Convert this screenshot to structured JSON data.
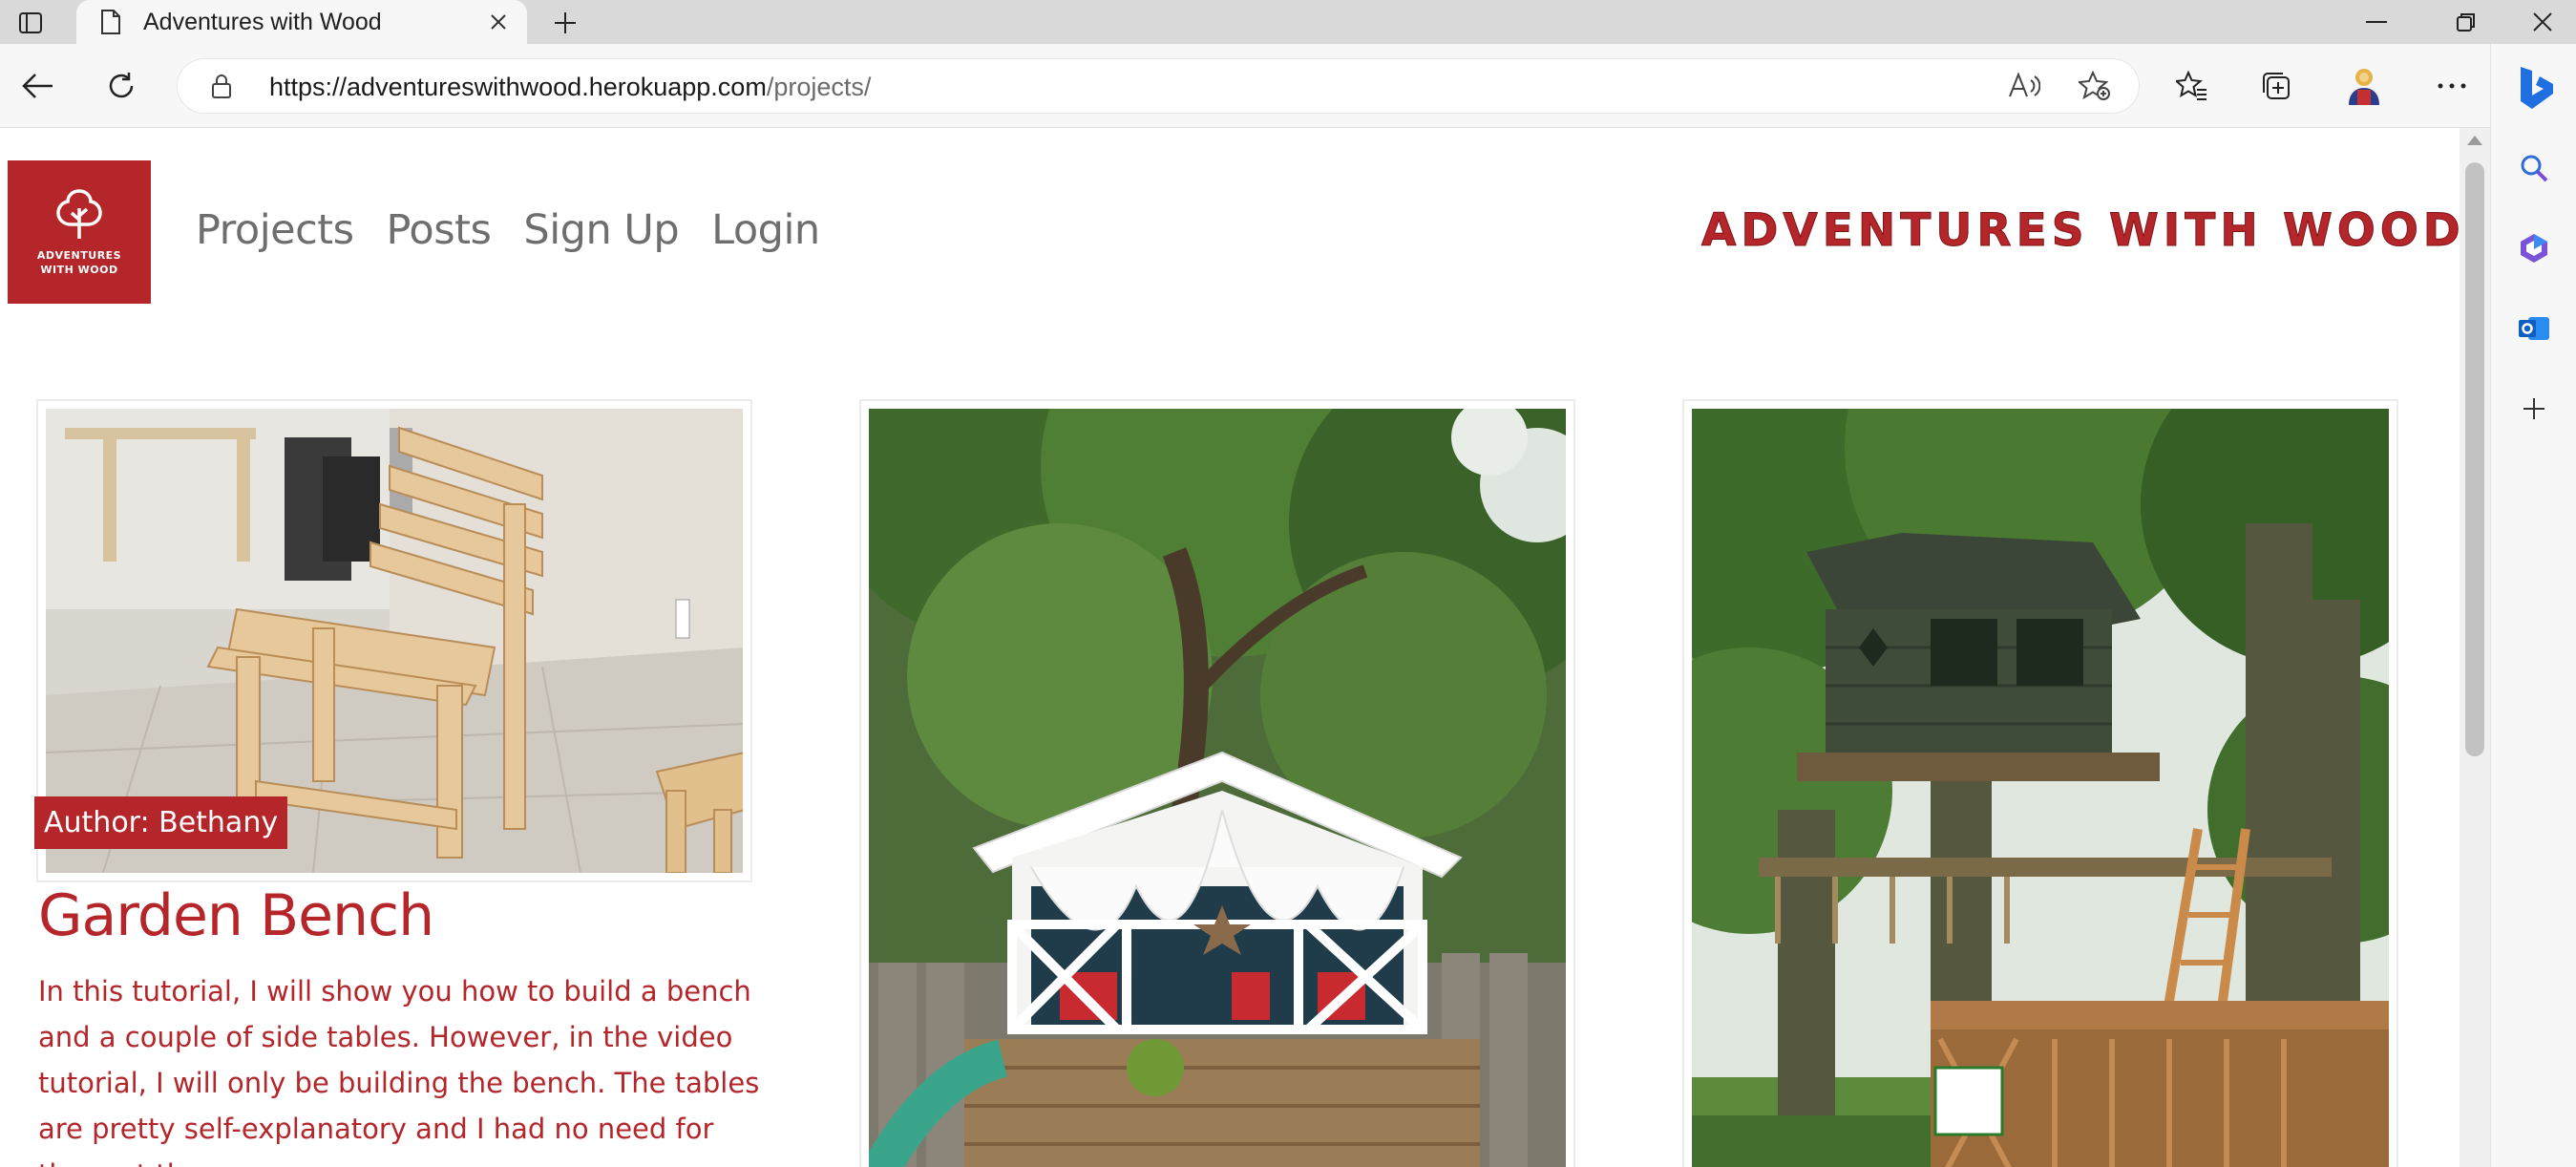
{
  "browser": {
    "tab_title": "Adventures with Wood",
    "url_host": "https://adventureswithwood.herokuapp.com",
    "url_path": "/projects/"
  },
  "site": {
    "logo_text": "ADVENTURES WITH WOOD",
    "brand_title": "Adventures with Wood",
    "nav": [
      "Projects",
      "Posts",
      "Sign Up",
      "Login"
    ]
  },
  "projects": [
    {
      "author_label": "Author: Bethany",
      "title": "Garden Bench",
      "description": "In this tutorial, I will show you how to build a bench and a couple of side tables. However, in the video tutorial, I will only be building the bench. The tables are pretty self-explanatory and I had no need for them at the",
      "image": "workshop-bench-photo"
    },
    {
      "image": "playhouse-under-tree-photo"
    },
    {
      "image": "treehouse-photo"
    }
  ],
  "colors": {
    "accent": "#b5262a",
    "nav_text": "#6e6e6e"
  }
}
